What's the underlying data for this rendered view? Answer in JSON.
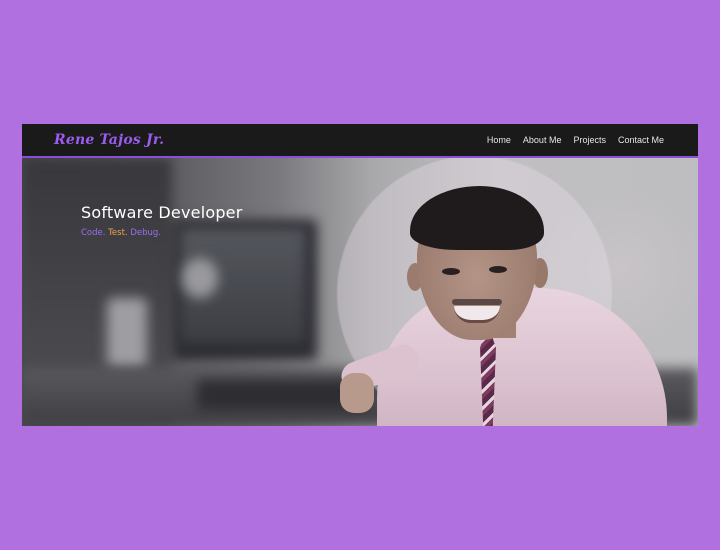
{
  "navbar": {
    "brand": "Rene Tajos Jr.",
    "links": [
      "Home",
      "About Me",
      "Projects",
      "Contact Me"
    ]
  },
  "hero": {
    "title": "Software Developer",
    "tagline": [
      "Code.",
      "Test.",
      "Debug."
    ]
  },
  "colors": {
    "page_background": "#b070e0",
    "navbar_background": "#1a1a1a",
    "accent_purple": "#9b5cf0",
    "accent_orange": "#f1a24a"
  }
}
